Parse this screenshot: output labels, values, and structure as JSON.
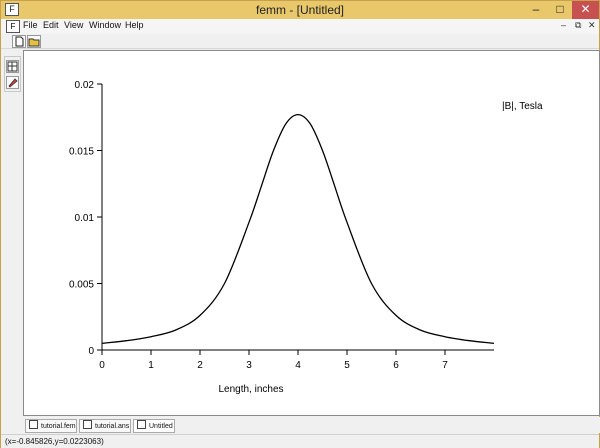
{
  "window": {
    "title": "femm - [Untitled]",
    "minimize_glyph": "–",
    "maximize_glyph": "□",
    "close_glyph": "✕"
  },
  "menu": {
    "items": [
      "File",
      "Edit",
      "View",
      "Window",
      "Help"
    ],
    "mdi_minimize": "–",
    "mdi_restore": "⧉",
    "mdi_close": "✕"
  },
  "toolbar": {
    "new_icon": "new-file-icon",
    "open_icon": "open-folder-icon"
  },
  "side_toolbar": {
    "icons": [
      "table-icon",
      "pen-icon"
    ]
  },
  "tabs": [
    {
      "label": "tutorial.fem",
      "icon": "document-icon"
    },
    {
      "label": "tutorial.ans",
      "icon": "solution-icon"
    },
    {
      "label": "Untitled",
      "icon": "plot-icon"
    }
  ],
  "status": {
    "coords": "(x=-0.845826,y=0.0223063)"
  },
  "chart_data": {
    "type": "line",
    "xlabel": "Length, inches",
    "ylabel": "",
    "legend_text": "|B|, Tesla",
    "legend_placement": "top-right",
    "grid": false,
    "xlim": [
      0,
      8
    ],
    "ylim": [
      0,
      0.02
    ],
    "xticks": [
      0,
      1,
      2,
      3,
      4,
      5,
      6,
      7
    ],
    "yticks": [
      0,
      0.005,
      0.01,
      0.015,
      0.02
    ],
    "ytick_labels": [
      "0",
      "0.005",
      "0.01",
      "0.015",
      "0.02"
    ],
    "color": "#000000",
    "x": [
      0,
      0.5,
      1,
      1.5,
      2,
      2.5,
      3,
      3.25,
      3.5,
      3.75,
      4,
      4.25,
      4.5,
      4.75,
      5,
      5.5,
      6,
      6.5,
      7,
      7.5,
      8
    ],
    "y": [
      0.0005,
      0.0007,
      0.001,
      0.0015,
      0.0026,
      0.005,
      0.0096,
      0.0123,
      0.015,
      0.017,
      0.0177,
      0.017,
      0.015,
      0.0123,
      0.0096,
      0.005,
      0.0026,
      0.0015,
      0.001,
      0.0007,
      0.0005
    ]
  }
}
